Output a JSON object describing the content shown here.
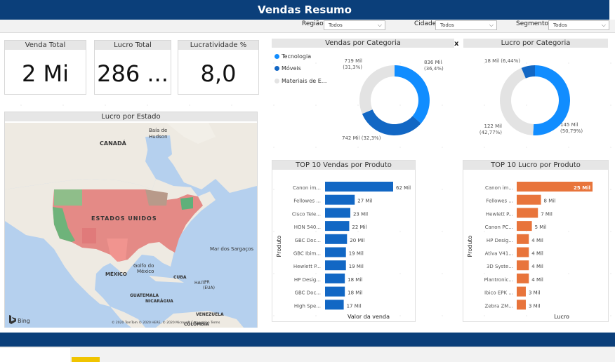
{
  "header": {
    "title": "Vendas Resumo"
  },
  "filters": [
    {
      "label": "Região:",
      "value": "Todos"
    },
    {
      "label": "Cidade",
      "value": "Todos"
    },
    {
      "label": "Segmento:",
      "value": "Todos"
    }
  ],
  "kpis": [
    {
      "title": "Venda Total",
      "value": "2 Mi"
    },
    {
      "title": "Lucro Total",
      "value": "286 ..."
    },
    {
      "title": "Lucratividade %",
      "value": "8,0"
    }
  ],
  "map": {
    "title": "Lucro por Estado",
    "labels": {
      "canada": "CANADÁ",
      "usa": "ESTADOS UNIDOS",
      "mexico": "MÉXICO",
      "hudson": "Baía de\nHudson",
      "sargacos": "Mar dos Sargaços",
      "golfo": "Golfo do\nMéxico",
      "cuba": "CUBA",
      "haiti": "HAITI",
      "pr": "PR\n(EUA)",
      "guatemala": "GUATEMALA",
      "nicaragua": "NICARÁGUA",
      "venezuela": "VENEZUELA",
      "colombia": "COLÔMBIA",
      "bing": "Bing",
      "copyright": "© 2020 TomTom © 2020 HERE, © 2020 Microsoft Corporation Terms"
    }
  },
  "vendas_categoria": {
    "title": "Vendas por Categoria",
    "close": "x",
    "legend": [
      {
        "name": "Tecnologia",
        "color": "#118dff"
      },
      {
        "name": "Móveis",
        "color": "#1267c4"
      },
      {
        "name": "Materiais de E...",
        "color": "#e3e3e3"
      }
    ],
    "labels": [
      "836 Mil\n(36,4%)",
      "742 Mil (32,3%)",
      "719 Mil\n(31,3%)"
    ]
  },
  "lucro_categoria": {
    "title": "Lucro por Categoria",
    "labels": [
      "145 Mil\n(50,79%)",
      "122 Mil\n(42,77%)",
      "18 Mil (6,44%)"
    ]
  },
  "chart_data": [
    {
      "type": "pie",
      "title": "Vendas por Categoria",
      "categories": [
        "Tecnologia",
        "Móveis",
        "Materiais de E..."
      ],
      "values": [
        836,
        742,
        719
      ],
      "percent": [
        36.4,
        32.3,
        31.3
      ],
      "colors": [
        "#118dff",
        "#1267c4",
        "#e3e3e3"
      ]
    },
    {
      "type": "pie",
      "title": "Lucro por Categoria",
      "categories": [
        "Tecnologia",
        "Materiais de E...",
        "Móveis"
      ],
      "values": [
        145,
        122,
        18
      ],
      "percent": [
        50.79,
        42.77,
        6.44
      ],
      "colors": [
        "#118dff",
        "#e3e3e3",
        "#1267c4"
      ]
    },
    {
      "type": "bar",
      "title": "TOP 10 Vendas por Produto",
      "xlabel": "Valor da venda",
      "ylabel": "Produto",
      "categories": [
        "Canon im...",
        "Fellowes ...",
        "Cisco Tele...",
        "HON 540...",
        "GBC Doc...",
        "GBC Ibim...",
        "Hewlett P...",
        "HP Desig...",
        "GBC Doc...",
        "High Spe..."
      ],
      "values": [
        62,
        27,
        23,
        22,
        20,
        19,
        19,
        18,
        18,
        17
      ],
      "value_labels": [
        "62 Mil",
        "27 Mil",
        "23 Mil",
        "22 Mil",
        "20 Mil",
        "19 Mil",
        "19 Mil",
        "18 Mil",
        "18 Mil",
        "17 Mil"
      ],
      "color": "#1267c4"
    },
    {
      "type": "bar",
      "title": "TOP 10 Lucro por Produto",
      "xlabel": "Lucro",
      "ylabel": "Produto",
      "categories": [
        "Canon im...",
        "Fellowes ...",
        "Hewlett P...",
        "Canon PC...",
        "HP Desig...",
        "Ativa V41...",
        "3D Syste...",
        "Plantronic...",
        "Ibico EPK ...",
        "Zebra ZM..."
      ],
      "values": [
        25,
        8,
        7,
        5,
        4,
        4,
        4,
        4,
        3,
        3
      ],
      "value_labels": [
        "25 Mil",
        "8 Mil",
        "7 Mil",
        "5 Mil",
        "4 Mil",
        "4 Mil",
        "4 Mil",
        "4 Mil",
        "3 Mil",
        "3 Mil"
      ],
      "color": "#e8743b"
    }
  ]
}
